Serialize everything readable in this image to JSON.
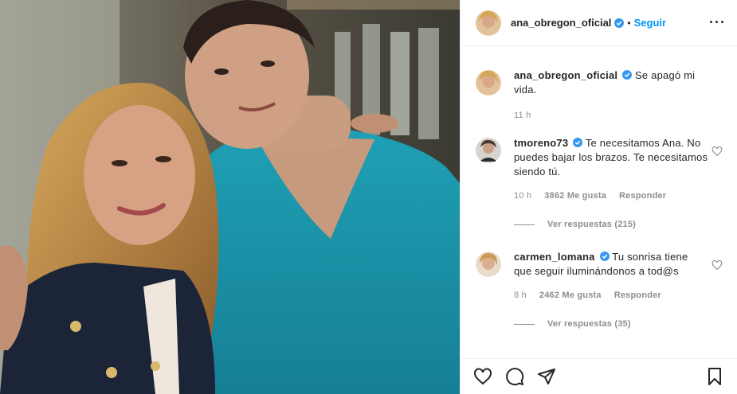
{
  "post": {
    "author": "ana_obregon_oficial",
    "follow_label": "Seguir",
    "separator": "•",
    "more_label": "···"
  },
  "caption": {
    "username": "ana_obregon_oficial",
    "text": "Se apagó mi vida.",
    "time": "11 h"
  },
  "comments": [
    {
      "username": "tmoreno73",
      "text": "Te necesitamos Ana. No puedes bajar los brazos. Te necesitamos siendo tú.",
      "time": "10 h",
      "likes": "3862 Me gusta",
      "reply_label": "Responder",
      "view_replies": "Ver respuestas (215)"
    },
    {
      "username": "carmen_lomana",
      "text": "Tu sonrisa tiene que seguir iluminándonos a tod@s",
      "time": "8 h",
      "likes": "2462 Me gusta",
      "reply_label": "Responder",
      "view_replies": "Ver respuestas (35)"
    }
  ],
  "colors": {
    "link": "#0095f6",
    "muted": "#8e8e8e",
    "text": "#262626",
    "verified": "#3897f0"
  },
  "icons": [
    "heart-icon",
    "comment-icon",
    "share-icon",
    "bookmark-icon",
    "more-icon",
    "verified-badge-icon"
  ]
}
